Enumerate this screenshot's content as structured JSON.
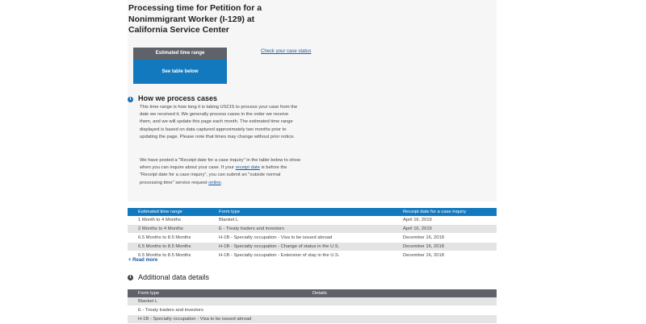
{
  "page": {
    "title": "Processing time for Petition for a Nonimmigrant Worker (I-129) at California Service Center"
  },
  "time_box": {
    "header": "Estimated time range",
    "value": "See table below"
  },
  "check_case_link": "Check your case status",
  "how_we_process": {
    "heading": "How we process cases",
    "para1": "This time range is how long it is taking USCIS to process your case from the date we received it. We generally process cases in the order we receive them, and we will update this page each month. The estimated time range displayed is based on data captured approximately two months prior to updating the page. Please note that times may change without prior notice.",
    "para2_before": "We have posted a \"Receipt date for a case inquiry\" in the table below to show when you can inquire about your case. If your ",
    "para2_link1": "receipt date",
    "para2_middle": " is before the \"Receipt date for a case inquiry\", you can submit an \"outside normal processing time\" service request ",
    "para2_link2": "online",
    "para2_end": "."
  },
  "processing_table": {
    "headers": [
      "Estimated time range",
      "Form type",
      "Receipt date for a case inquiry"
    ],
    "rows": [
      [
        "1 Month to 4 Months",
        "Blanket L",
        "April 16, 2019"
      ],
      [
        "2 Months to 4 Months",
        "E - Treaty traders and investors",
        "April 16, 2019"
      ],
      [
        "6.5 Months to 8.5 Months",
        "H-1B - Specialty occupation - Visa to be issued abroad",
        "December 16, 2018"
      ],
      [
        "6.5 Months to 8.5 Months",
        "H-1B - Specialty occupation - Change of status in the U.S.",
        "December 16, 2018"
      ],
      [
        "6.5 Months to 8.5 Months",
        "H-1B - Specialty occupation - Extension of stay in the U.S.",
        "December 16, 2018"
      ]
    ]
  },
  "read_more": "+ Read more",
  "additional": {
    "heading": "Additional data details",
    "headers": [
      "Form type",
      "Details"
    ],
    "rows": [
      [
        "Blanket L",
        ""
      ],
      [
        "E - Treaty traders and investors",
        ""
      ],
      [
        "H-1B - Specialty occupation - Visa to be issued abroad",
        ""
      ]
    ]
  },
  "colors": {
    "accent_blue": "#1279bf",
    "header_gray": "#5f6369",
    "link_blue": "#1a5aa0"
  },
  "icons": {
    "info": "info-icon"
  }
}
